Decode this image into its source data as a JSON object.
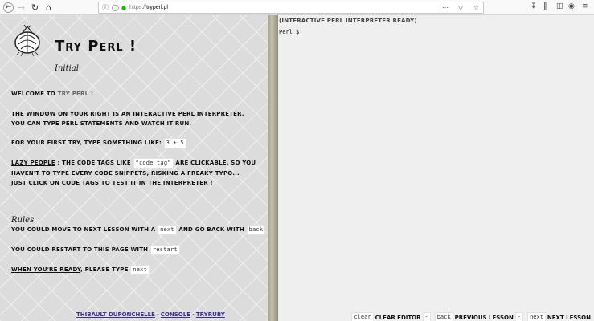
{
  "browser": {
    "url_proto": "https://",
    "url_host": "tryperl.pl",
    "icons": [
      "back-icon",
      "forward-icon",
      "reload-icon",
      "home-icon",
      "info-icon",
      "shield-icon",
      "lock-icon",
      "page-actions-icon",
      "pocket-icon",
      "bookmark-star-icon",
      "download-icon",
      "library-icon",
      "sidebar-icon",
      "account-icon",
      "menu-icon"
    ]
  },
  "lesson": {
    "title": "Try Perl !",
    "subtitle": "Initial",
    "welcome_prefix": "Welcome to ",
    "welcome_highlight": "Try Perl",
    "welcome_suffix": " !",
    "intro_line1": "The window on your right is an interactive Perl interpreter.",
    "intro_line2": "You can type Perl statements and watch it run.",
    "first_try_text": "For your first try, type something like: ",
    "first_try_code": "3 + 5",
    "lazy_label": "Lazy people",
    "lazy_text_1": " : the code tags like ",
    "lazy_code": "\"code tag\"",
    "lazy_text_2": " are clickable, so you haven't to type every code snippets, risking a freaky typo... just click on code tags to test it in the interpreter !",
    "rules_heading": "Rules",
    "rule1_text_1": "You could move to next lesson with a ",
    "rule1_code_next": "next",
    "rule1_text_2": " and go back with ",
    "rule1_code_back": "back",
    "rule2_text": "You could restart to this page with ",
    "rule2_code": "restart",
    "ready_label": "When you're ready",
    "ready_text": ", please type ",
    "ready_code": "next"
  },
  "footer": {
    "link1": "Thibault Duponchelle",
    "link2": "Console",
    "link3": "TryRuby",
    "sep": "-"
  },
  "console": {
    "header": "(Interactive Perl interpreter ready)",
    "prompt": "Perl $",
    "clear_code": "clear",
    "clear_label": "Clear editor",
    "back_code": "back",
    "back_label": "Previous lesson",
    "next_code": "next",
    "next_label": "Next lesson",
    "sep": "-"
  }
}
